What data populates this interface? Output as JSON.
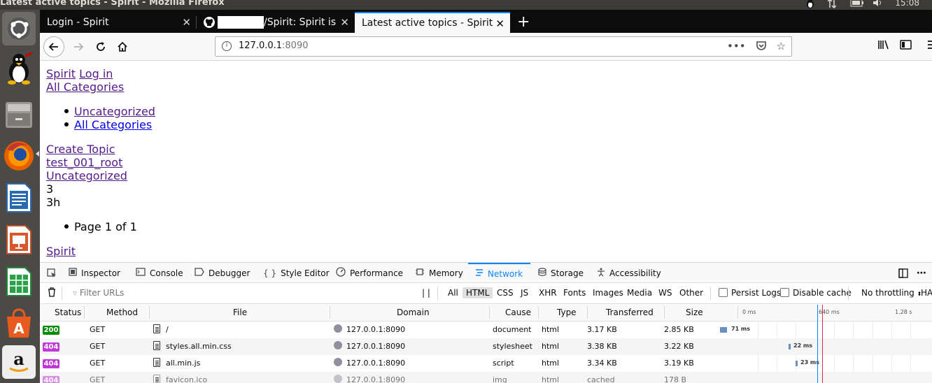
{
  "os": {
    "window_title": "Latest active topics - Spirit - Mozilla Firefox",
    "clock": "15:08"
  },
  "browser": {
    "tabs": [
      {
        "label": "Login - Spirit",
        "active": false
      },
      {
        "label": "/Spirit: Spirit is",
        "active": false
      },
      {
        "label": "Latest active topics - Spirit",
        "active": true
      }
    ],
    "new_tab": "+",
    "url_host": "127.0.0.1",
    "url_port": ":8090"
  },
  "page": {
    "brand": "Spirit",
    "login": "Log in",
    "all_categories_heading": "All Categories",
    "category_list": [
      "Uncategorized",
      "All Categories"
    ],
    "create_topic": "Create Topic",
    "topic_title": "test_001_root",
    "topic_category": "Uncategorized",
    "topic_count": "3",
    "topic_age": "3h",
    "pagination": "Page 1 of 1",
    "footer_link": "Spirit"
  },
  "devtools": {
    "tabs": [
      "Inspector",
      "Console",
      "Debugger",
      "Style Editor",
      "Performance",
      "Memory",
      "Network",
      "Storage",
      "Accessibility"
    ],
    "active_tab": "Network",
    "filter_placeholder": "Filter URLs",
    "pause": "| |",
    "type_filters": [
      "All",
      "HTML",
      "CSS",
      "JS",
      "XHR",
      "Fonts",
      "Images",
      "Media",
      "WS",
      "Other"
    ],
    "active_type_filter": "HTML",
    "persist_logs": "Persist Logs",
    "disable_cache": "Disable cache",
    "throttling": "No throttling",
    "har": "HAR",
    "columns": [
      "Status",
      "Method",
      "File",
      "Domain",
      "Cause",
      "Type",
      "Transferred",
      "Size"
    ],
    "waterfall_ticks": [
      "0 ms",
      "640 ms",
      "1.28 s"
    ],
    "rows": [
      {
        "status": "200",
        "method": "GET",
        "file": "/",
        "domain": "127.0.0.1:8090",
        "cause": "document",
        "type": "html",
        "transferred": "3.17 KB",
        "size": "2.85 KB",
        "timing": "71 ms"
      },
      {
        "status": "404",
        "method": "GET",
        "file": "styles.all.min.css",
        "domain": "127.0.0.1:8090",
        "cause": "stylesheet",
        "type": "html",
        "transferred": "3.38 KB",
        "size": "3.22 KB",
        "timing": "22 ms"
      },
      {
        "status": "404",
        "method": "GET",
        "file": "all.min.js",
        "domain": "127.0.0.1:8090",
        "cause": "script",
        "type": "html",
        "transferred": "3.34 KB",
        "size": "3.19 KB",
        "timing": "23 ms"
      },
      {
        "status": "404",
        "method": "GET",
        "file": "favicon.ico",
        "domain": "127.0.0.1:8090",
        "cause": "img",
        "type": "html",
        "transferred": "cached",
        "size": "178 B",
        "timing": ""
      }
    ]
  }
}
